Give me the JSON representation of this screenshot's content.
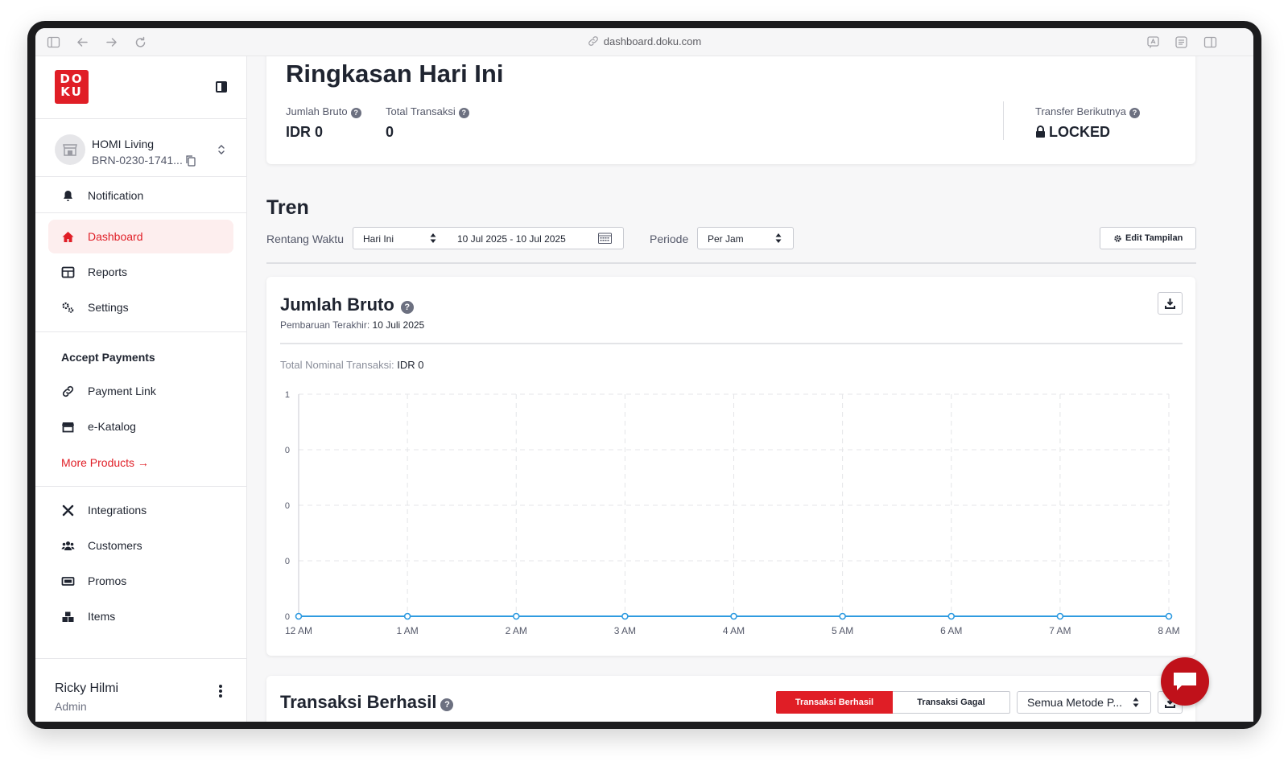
{
  "browser": {
    "url": "dashboard.doku.com"
  },
  "sidebar": {
    "logo_text": "DO KU",
    "merchant": {
      "name": "HOMI Living",
      "id": "BRN-0230-1741..."
    },
    "notification": "Notification",
    "items": [
      {
        "label": "Dashboard",
        "icon": "home-icon",
        "active": true
      },
      {
        "label": "Reports",
        "icon": "table-icon"
      },
      {
        "label": "Settings",
        "icon": "gears-icon"
      }
    ],
    "accept_payments": {
      "title": "Accept Payments",
      "items": [
        {
          "label": "Payment Link",
          "icon": "link-icon"
        },
        {
          "label": "e-Katalog",
          "icon": "store-icon"
        }
      ],
      "more": "More Products →"
    },
    "tools": [
      {
        "label": "Integrations",
        "icon": "tools-icon"
      },
      {
        "label": "Customers",
        "icon": "users-icon"
      },
      {
        "label": "Promos",
        "icon": "ticket-icon"
      },
      {
        "label": "Items",
        "icon": "boxes-icon"
      }
    ],
    "user": {
      "name": "Ricky Hilmi",
      "role": "Admin"
    }
  },
  "summary": {
    "title": "Ringkasan Hari Ini",
    "gross_label": "Jumlah Bruto",
    "gross_value": "IDR 0",
    "trx_label": "Total Transaksi",
    "trx_value": "0",
    "transfer_label": "Transfer Berikutnya",
    "transfer_value": "LOCKED"
  },
  "trend": {
    "title": "Tren",
    "range_label": "Rentang Waktu",
    "range_value": "Hari Ini",
    "date_range": "10 Jul 2025 - 10 Jul 2025",
    "period_label": "Periode",
    "period_value": "Per Jam",
    "edit_button": "Edit Tampilan"
  },
  "gross_chart": {
    "title": "Jumlah Bruto",
    "updated_label": "Pembaruan Terakhir:",
    "updated_value": "10 Juli 2025",
    "total_label": "Total Nominal Transaksi:",
    "total_value": "IDR 0"
  },
  "chart_data": {
    "type": "line",
    "x": [
      "12 AM",
      "1 AM",
      "2 AM",
      "3 AM",
      "4 AM",
      "5 AM",
      "6 AM",
      "7 AM",
      "8 AM"
    ],
    "series": [
      {
        "values": [
          0,
          0,
          0,
          0,
          0,
          0,
          0,
          0,
          0
        ]
      }
    ],
    "y_tick_labels": [
      "0",
      "0",
      "0",
      "0",
      "1"
    ],
    "ylim": [
      0,
      1
    ],
    "grid": true,
    "line_color": "#2f9be0"
  },
  "transactions": {
    "title": "Transaksi Berhasil",
    "tab_success": "Transaksi Berhasil",
    "tab_failed": "Transaksi Gagal",
    "method_value": "Semua Metode P..."
  },
  "colors": {
    "brand": "#e01e26",
    "active_bg": "#fdeeee"
  }
}
